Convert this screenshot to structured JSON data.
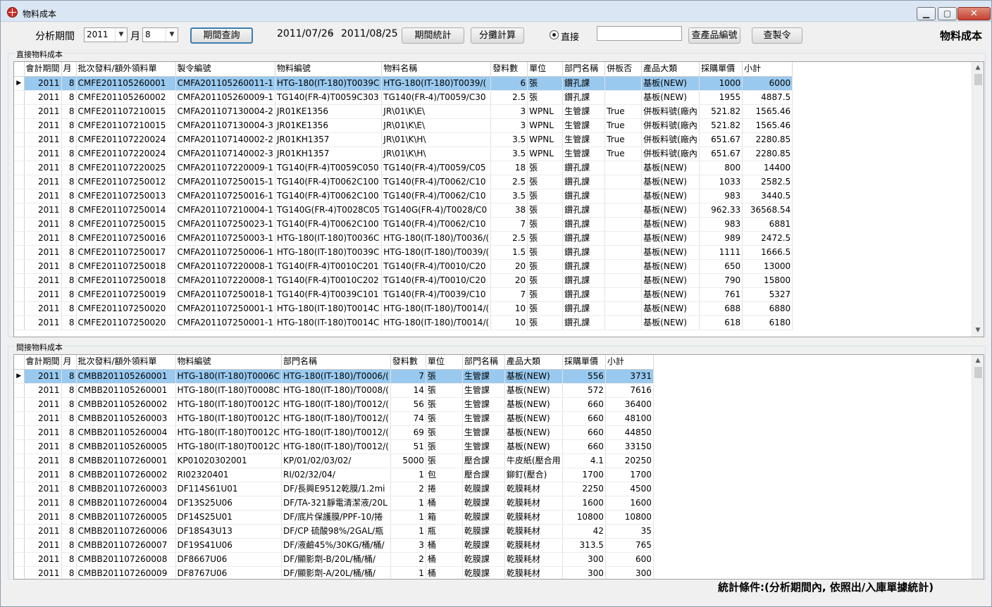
{
  "window": {
    "title": "物料成本",
    "minimize": "▁",
    "maximize": "▢",
    "close": "✕"
  },
  "toolbar": {
    "period_label": "分析期間",
    "year_value": "2011",
    "month_label": "月",
    "month_value": "8",
    "query_button": "期間查詢",
    "date_from": "2011/07/26",
    "date_sep": "-",
    "date_to": "2011/08/25",
    "stats_button": "期間統計",
    "allocate_button": "分攤計算",
    "direct_radio_label": "直接",
    "search_value": "",
    "product_code_button": "查產品編號",
    "order_button": "查製令",
    "form_title": "物料成本"
  },
  "direct": {
    "group_label": "直接物料成本",
    "columns": [
      "會計期間",
      "月",
      "批次發料/額外領料單",
      "製令編號",
      "物料編號",
      "物料名稱",
      "發料數",
      "單位",
      "部門名稱",
      "併板否",
      "產品大類",
      "採購單價",
      "小計"
    ],
    "rows": [
      [
        "2011",
        "8",
        "CMFE201105260001",
        "CMFA201105260011-1",
        "HTG-180(IT-180)T0039C",
        "HTG-180(IT-180)T0039/(",
        "6",
        "張",
        "鑽孔課",
        "",
        "基板(NEW)",
        "1000",
        "6000"
      ],
      [
        "2011",
        "8",
        "CMFE201105260002",
        "CMFA201105260009-1",
        "TG140(FR-4)T0059C303",
        "TG140(FR-4)/T0059/C30",
        "2.5",
        "張",
        "鑽孔課",
        "",
        "基板(NEW)",
        "1955",
        "4887.5"
      ],
      [
        "2011",
        "8",
        "CMFE201107210015",
        "CMFA201107130004-2",
        "JR01KE1356",
        "JR\\01\\K\\E\\",
        "3",
        "WPNL",
        "生管課",
        "True",
        "併板料號(廠內",
        "521.82",
        "1565.46"
      ],
      [
        "2011",
        "8",
        "CMFE201107210015",
        "CMFA201107130004-3",
        "JR01KE1356",
        "JR\\01\\K\\E\\",
        "3",
        "WPNL",
        "生管課",
        "True",
        "併板料號(廠內",
        "521.82",
        "1565.46"
      ],
      [
        "2011",
        "8",
        "CMFE201107220024",
        "CMFA201107140002-2",
        "JR01KH1357",
        "JR\\01\\K\\H\\",
        "3.5",
        "WPNL",
        "生管課",
        "True",
        "併板料號(廠內",
        "651.67",
        "2280.85"
      ],
      [
        "2011",
        "8",
        "CMFE201107220024",
        "CMFA201107140002-3",
        "JR01KH1357",
        "JR\\01\\K\\H\\",
        "3.5",
        "WPNL",
        "生管課",
        "True",
        "併板料號(廠內",
        "651.67",
        "2280.85"
      ],
      [
        "2011",
        "8",
        "CMFE201107220025",
        "CMFA201107220009-1",
        "TG140(FR-4)T0059C050",
        "TG140(FR-4)/T0059/C05",
        "18",
        "張",
        "鑽孔課",
        "",
        "基板(NEW)",
        "800",
        "14400"
      ],
      [
        "2011",
        "8",
        "CMFE201107250012",
        "CMFA201107250015-1",
        "TG140(FR-4)T0062C100",
        "TG140(FR-4)/T0062/C10",
        "2.5",
        "張",
        "鑽孔課",
        "",
        "基板(NEW)",
        "1033",
        "2582.5"
      ],
      [
        "2011",
        "8",
        "CMFE201107250013",
        "CMFA201107250016-1",
        "TG140(FR-4)T0062C100",
        "TG140(FR-4)/T0062/C10",
        "3.5",
        "張",
        "鑽孔課",
        "",
        "基板(NEW)",
        "983",
        "3440.5"
      ],
      [
        "2011",
        "8",
        "CMFE201107250014",
        "CMFA201107210004-1",
        "TG140G(FR-4)T0028C05",
        "TG140G(FR-4)/T0028/C0",
        "38",
        "張",
        "鑽孔課",
        "",
        "基板(NEW)",
        "962.33",
        "36568.54"
      ],
      [
        "2011",
        "8",
        "CMFE201107250015",
        "CMFA201107250023-1",
        "TG140(FR-4)T0062C100",
        "TG140(FR-4)/T0062/C10",
        "7",
        "張",
        "鑽孔課",
        "",
        "基板(NEW)",
        "983",
        "6881"
      ],
      [
        "2011",
        "8",
        "CMFE201107250016",
        "CMFA201107250003-1",
        "HTG-180(IT-180)T0036C",
        "HTG-180(IT-180)/T0036/(",
        "2.5",
        "張",
        "鑽孔課",
        "",
        "基板(NEW)",
        "989",
        "2472.5"
      ],
      [
        "2011",
        "8",
        "CMFE201107250017",
        "CMFA201107250006-1",
        "HTG-180(IT-180)T0039C",
        "HTG-180(IT-180)/T0039/(",
        "1.5",
        "張",
        "鑽孔課",
        "",
        "基板(NEW)",
        "1111",
        "1666.5"
      ],
      [
        "2011",
        "8",
        "CMFE201107250018",
        "CMFA201107220008-1",
        "TG140(FR-4)T0010C201",
        "TG140(FR-4)/T0010/C20",
        "20",
        "張",
        "鑽孔課",
        "",
        "基板(NEW)",
        "650",
        "13000"
      ],
      [
        "2011",
        "8",
        "CMFE201107250018",
        "CMFA201107220008-1",
        "TG140(FR-4)T0010C202",
        "TG140(FR-4)/T0010/C20",
        "20",
        "張",
        "鑽孔課",
        "",
        "基板(NEW)",
        "790",
        "15800"
      ],
      [
        "2011",
        "8",
        "CMFE201107250019",
        "CMFA201107250018-1",
        "TG140(FR-4)T0039C101",
        "TG140(FR-4)/T0039/C10",
        "7",
        "張",
        "鑽孔課",
        "",
        "基板(NEW)",
        "761",
        "5327"
      ],
      [
        "2011",
        "8",
        "CMFE201107250020",
        "CMFA201107250001-1",
        "HTG-180(IT-180)T0014C",
        "HTG-180(IT-180)/T0014/(",
        "10",
        "張",
        "鑽孔課",
        "",
        "基板(NEW)",
        "688",
        "6880"
      ],
      [
        "2011",
        "8",
        "CMFE201107250020",
        "CMFA201107250001-1",
        "HTG-180(IT-180)T0014C",
        "HTG-180(IT-180)/T0014/(",
        "10",
        "張",
        "鑽孔課",
        "",
        "基板(NEW)",
        "618",
        "6180"
      ]
    ]
  },
  "indirect": {
    "group_label": "間接物料成本",
    "columns": [
      "會計期間",
      "月",
      "批次發料/額外領料單",
      "物料編號",
      "部門名稱",
      "發料數",
      "單位",
      "部門名稱",
      "產品大類",
      "採購單價",
      "小計"
    ],
    "rows": [
      [
        "2011",
        "8",
        "CMBB201105260001",
        "HTG-180(IT-180)T0006C",
        "HTG-180(IT-180)/T0006/(",
        "7",
        "張",
        "生管課",
        "基板(NEW)",
        "556",
        "3731"
      ],
      [
        "2011",
        "8",
        "CMBB201105260001",
        "HTG-180(IT-180)T0008C",
        "HTG-180(IT-180)/T0008/(",
        "14",
        "張",
        "生管課",
        "基板(NEW)",
        "572",
        "7616"
      ],
      [
        "2011",
        "8",
        "CMBB201105260002",
        "HTG-180(IT-180)T0012C",
        "HTG-180(IT-180)/T0012/(",
        "56",
        "張",
        "生管課",
        "基板(NEW)",
        "660",
        "36400"
      ],
      [
        "2011",
        "8",
        "CMBB201105260003",
        "HTG-180(IT-180)T0012C",
        "HTG-180(IT-180)/T0012/(",
        "74",
        "張",
        "生管課",
        "基板(NEW)",
        "660",
        "48100"
      ],
      [
        "2011",
        "8",
        "CMBB201105260004",
        "HTG-180(IT-180)T0012C",
        "HTG-180(IT-180)/T0012/(",
        "69",
        "張",
        "生管課",
        "基板(NEW)",
        "660",
        "44850"
      ],
      [
        "2011",
        "8",
        "CMBB201105260005",
        "HTG-180(IT-180)T0012C",
        "HTG-180(IT-180)/T0012/(",
        "51",
        "張",
        "生管課",
        "基板(NEW)",
        "660",
        "33150"
      ],
      [
        "2011",
        "8",
        "CMBB201107260001",
        "KP01020302001",
        "KP/01/02/03/02/",
        "5000",
        "張",
        "壓合課",
        "牛皮紙(壓合用",
        "4.1",
        "20250"
      ],
      [
        "2011",
        "8",
        "CMBB201107260002",
        "RI02320401",
        "RI/02/32/04/",
        "1",
        "包",
        "壓合課",
        "鉚釘(壓合)",
        "1700",
        "1700"
      ],
      [
        "2011",
        "8",
        "CMBB201107260003",
        "DF114S61U01",
        "DF/長興E9512乾膜/1.2mi",
        "2",
        "捲",
        "乾膜課",
        "乾膜耗材",
        "2250",
        "4500"
      ],
      [
        "2011",
        "8",
        "CMBB201107260004",
        "DF13S25U06",
        "DF/TA-321靜電清潔液/20L",
        "1",
        "桶",
        "乾膜課",
        "乾膜耗材",
        "1600",
        "1600"
      ],
      [
        "2011",
        "8",
        "CMBB201107260005",
        "DF14S25U01",
        "DF/底片保護膜/PPF-10/捲",
        "1",
        "箱",
        "乾膜課",
        "乾膜耗材",
        "10800",
        "10800"
      ],
      [
        "2011",
        "8",
        "CMBB201107260006",
        "DF18S43U13",
        "DF/CP 硫酸98%/2GAL/瓶",
        "1",
        "瓶",
        "乾膜課",
        "乾膜耗材",
        "42",
        "35"
      ],
      [
        "2011",
        "8",
        "CMBB201107260007",
        "DF19S41U06",
        "DF/液鹼45%/30KG/桶/桶/",
        "3",
        "桶",
        "乾膜課",
        "乾膜耗材",
        "313.5",
        "765"
      ],
      [
        "2011",
        "8",
        "CMBB201107260008",
        "DF8667U06",
        "DF/顯影劑-B/20L/桶/桶/",
        "2",
        "桶",
        "乾膜課",
        "乾膜耗材",
        "300",
        "600"
      ],
      [
        "2011",
        "8",
        "CMBB201107260009",
        "DF8767U06",
        "DF/顯影劑-A/20L/桶/桶/",
        "1",
        "桶",
        "乾膜課",
        "乾膜耗材",
        "300",
        "300"
      ]
    ]
  },
  "footer": {
    "note": "統計條件:(分析期間內, 依照出/入庫單據統計)"
  },
  "icons": {
    "row_indicator": "▶",
    "dropdown": "▼",
    "scroll_up": "▲",
    "scroll_down": "▼"
  }
}
